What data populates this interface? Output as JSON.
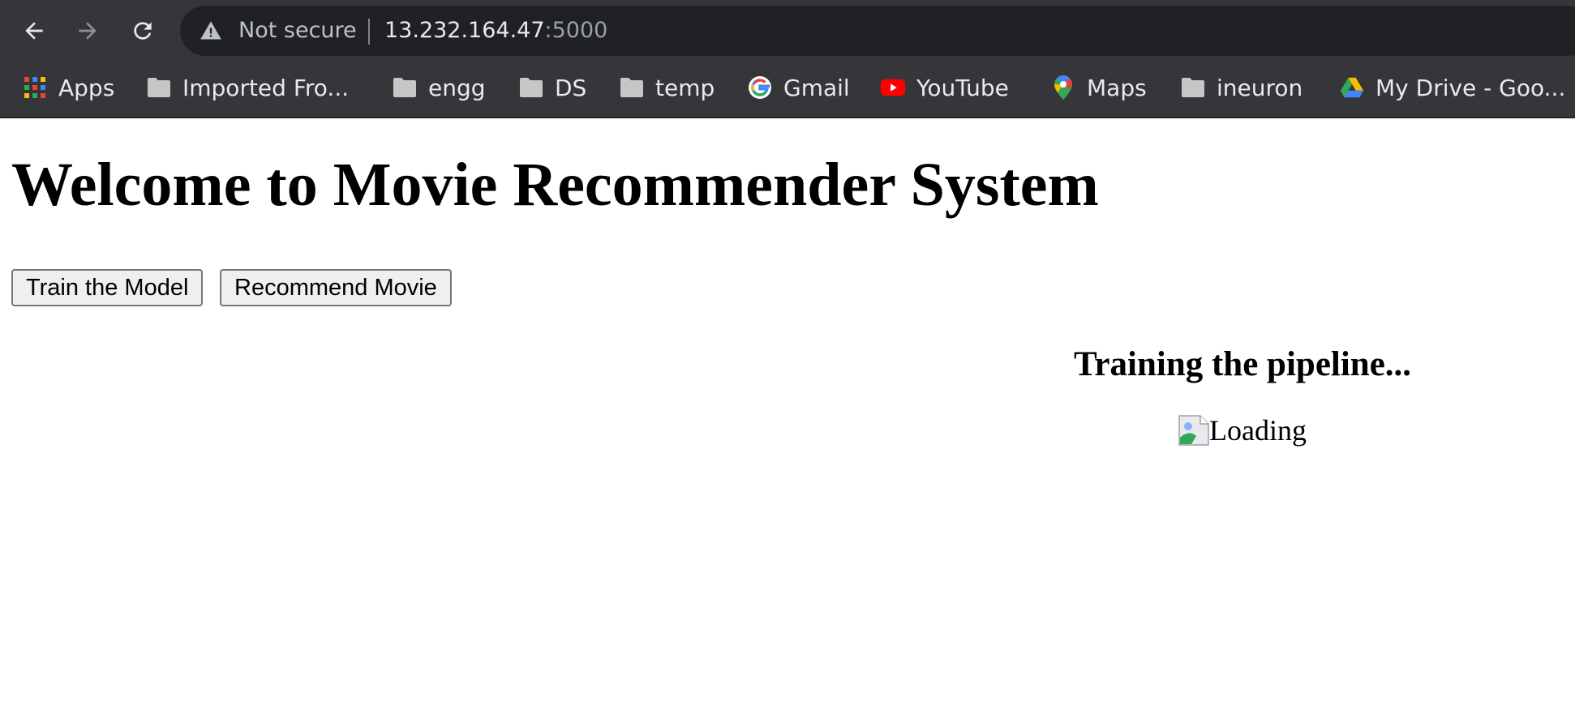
{
  "browser": {
    "security_label": "Not secure",
    "url_host": "13.232.164.47",
    "url_port": ":5000",
    "bookmarks": [
      {
        "label": "Apps",
        "icon": "apps-grid-icon"
      },
      {
        "label": "Imported Fro...",
        "icon": "folder-icon"
      },
      {
        "label": "engg",
        "icon": "folder-icon"
      },
      {
        "label": "DS",
        "icon": "folder-icon"
      },
      {
        "label": "temp",
        "icon": "folder-icon"
      },
      {
        "label": "Gmail",
        "icon": "google-icon"
      },
      {
        "label": "YouTube",
        "icon": "youtube-icon"
      },
      {
        "label": "Maps",
        "icon": "maps-icon"
      },
      {
        "label": "ineuron",
        "icon": "folder-icon"
      },
      {
        "label": "My Drive - Goo...",
        "icon": "google-drive-icon"
      }
    ]
  },
  "page": {
    "title": "Welcome to Movie Recommender System",
    "train_button": "Train the Model",
    "recommend_button": "Recommend Movie",
    "status_heading": "Training the pipeline...",
    "loading_alt": "Loading"
  },
  "colors": {
    "chrome_bg": "#35363a",
    "omnibox_bg": "#202124",
    "chrome_text": "#e8eaed",
    "button_bg": "#efefef"
  }
}
